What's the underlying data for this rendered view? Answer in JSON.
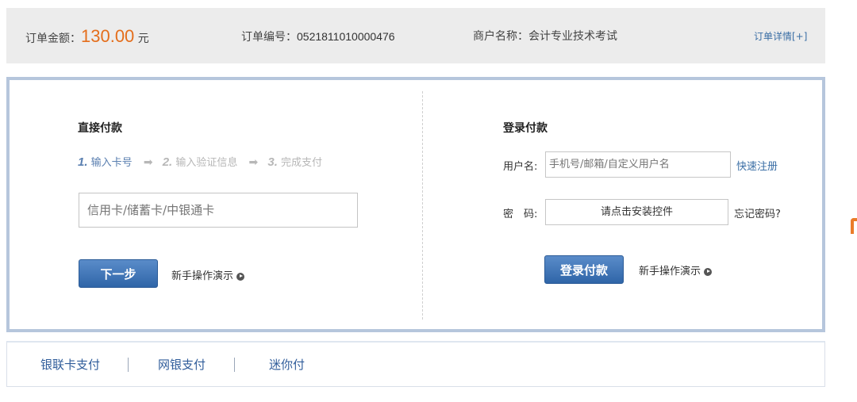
{
  "order": {
    "amount_label": "订单金额：",
    "amount_value": "130.00",
    "amount_unit": " 元",
    "order_no_label": "订单编号：",
    "order_no_value": "0521811010000476",
    "merchant_label": "商户名称：",
    "merchant_value": "会计专业技术考试",
    "detail_link": "订单详情[+]"
  },
  "direct_pay": {
    "title": "直接付款",
    "steps": [
      {
        "num": "1.",
        "label": "输入卡号"
      },
      {
        "num": "2.",
        "label": "输入验证信息"
      },
      {
        "num": "3.",
        "label": "完成支付"
      }
    ],
    "card_placeholder": "信用卡/储蓄卡/中银通卡",
    "next_button": "下一步",
    "demo_link": "新手操作演示"
  },
  "login_pay": {
    "title": "登录付款",
    "username_label": "用户名:",
    "username_placeholder": "手机号/邮箱/自定义用户名",
    "register_link": "快速注册",
    "password_label": "密　码:",
    "password_box_text": "请点击安装控件",
    "forgot_link": "忘记密码?",
    "login_button": "登录付款",
    "demo_link": "新手操作演示"
  },
  "tabs": [
    {
      "label": "银联卡支付"
    },
    {
      "label": "网银支付"
    },
    {
      "label": "迷你付"
    }
  ],
  "colors": {
    "accent_amount": "#e46e1c",
    "link_blue": "#3a6ea5",
    "button_blue": "#3a70b3",
    "panel_border": "#b6c6dc"
  }
}
